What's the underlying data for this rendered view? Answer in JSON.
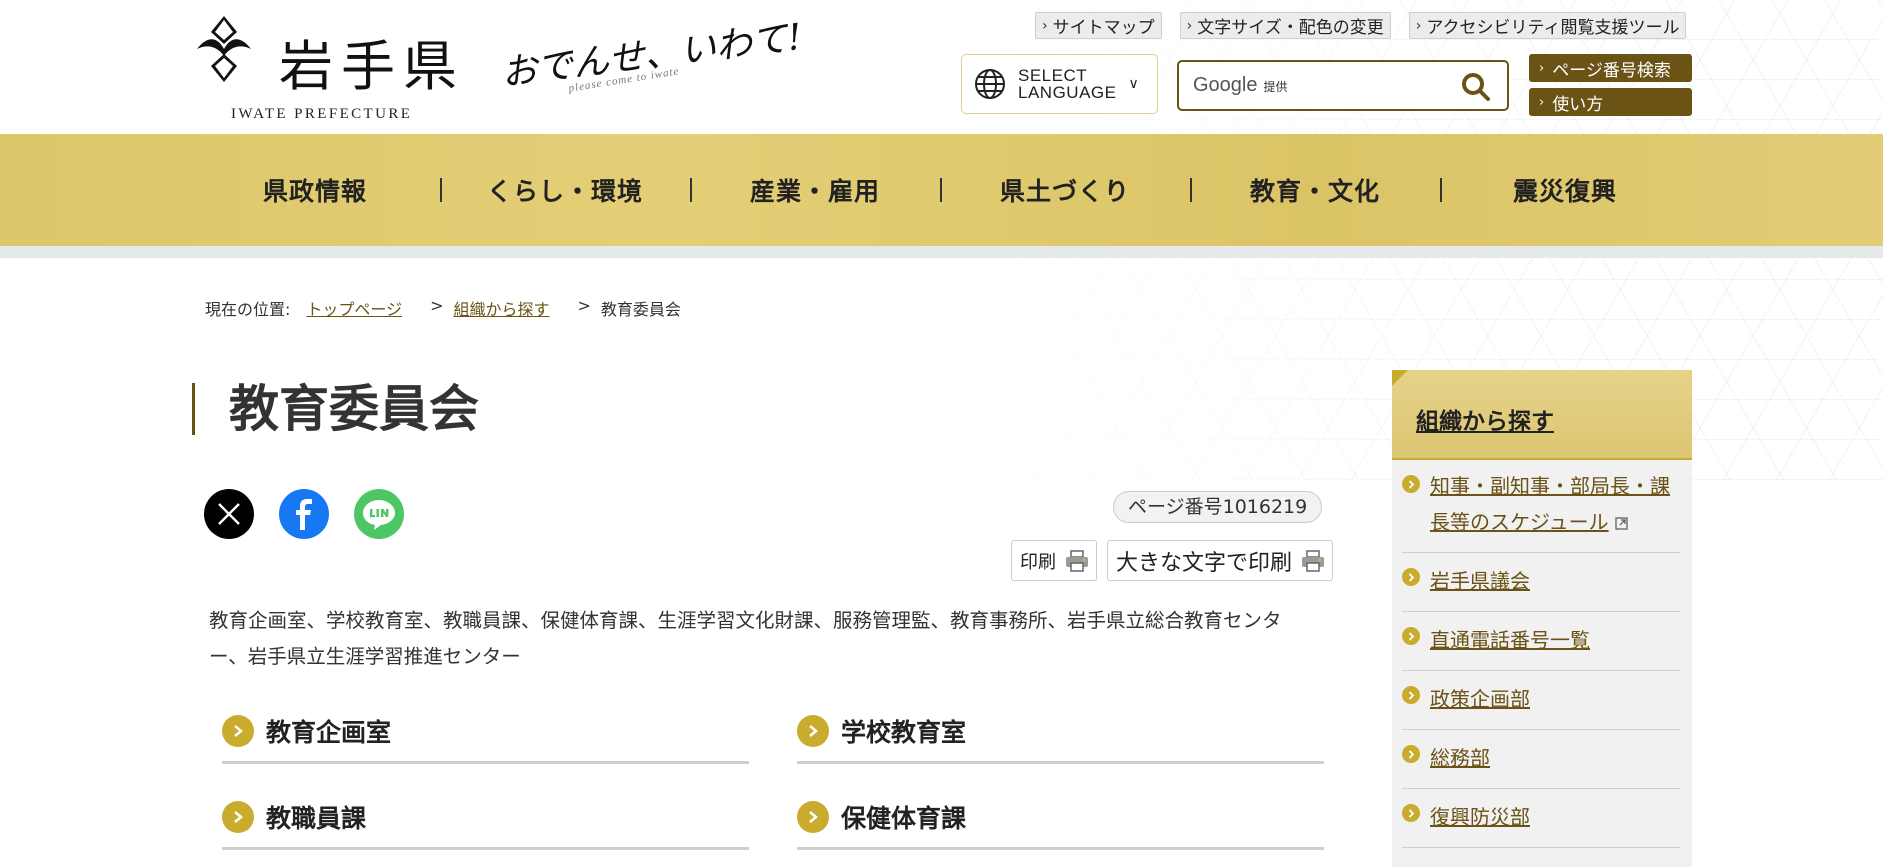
{
  "header": {
    "logo_text": "岩手県",
    "logo_sub": "IWATE PREFECTURE",
    "slogan": "おでんせ、いわて!",
    "slogan_sub": "please come to iwate",
    "util_links": [
      "サイトマップ",
      "文字サイズ・配色の変更",
      "アクセシビリティ閲覧支援ツール"
    ],
    "language": {
      "line1": "SELECT",
      "line2": "LANGUAGE"
    },
    "search": {
      "brand": "Google",
      "provided": "提供",
      "value": ""
    },
    "side_buttons": [
      "ページ番号検索",
      "使い方"
    ]
  },
  "gnav": {
    "items": [
      "県政情報",
      "くらし・環境",
      "産業・雇用",
      "県土づくり",
      "教育・文化",
      "震災復興"
    ]
  },
  "breadcrumb": {
    "label": "現在の位置:",
    "links": [
      "トップページ",
      "組織から探す"
    ],
    "separator": ">",
    "current": "教育委員会"
  },
  "main": {
    "title": "教育委員会",
    "page_number": "ページ番号1016219",
    "print": "印刷",
    "print_large": "大きな文字で印刷",
    "description": "教育企画室、学校教育室、教職員課、保健体育課、生涯学習文化財課、服務管理監、教育事務所、岩手県立総合教育センター、岩手県立生涯学習推進センター",
    "sections": [
      "教育企画室",
      "学校教育室",
      "教職員課",
      "保健体育課"
    ]
  },
  "sidebar": {
    "title": "組織から探す",
    "items": [
      "知事・副知事・部局長・課長等のスケジュール",
      "岩手県議会",
      "直通電話番号一覧",
      "政策企画部",
      "総務部",
      "復興防災部"
    ]
  },
  "colors": {
    "brand_brown": "#6b5215",
    "nav_gold": "#dcc66a",
    "accent_gold": "#c9ab2e"
  }
}
